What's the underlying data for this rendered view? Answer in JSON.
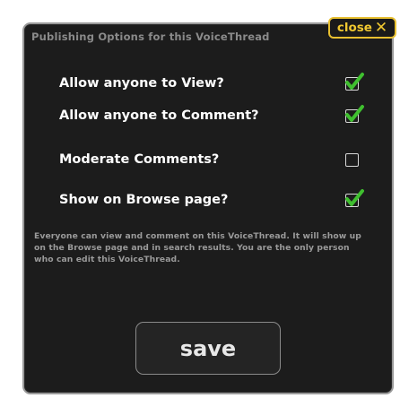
{
  "dialog": {
    "title": "Publishing Options for this VoiceThread",
    "close_label": "close",
    "close_glyph": "✕",
    "options": [
      {
        "label": "Allow anyone to View?",
        "checked": true
      },
      {
        "label": "Allow anyone to Comment?",
        "checked": true
      },
      {
        "label": "Moderate Comments?",
        "checked": false
      },
      {
        "label": "Show on Browse page?",
        "checked": true
      }
    ],
    "info": "Everyone can view and comment on this VoiceThread. It will show up on the Browse page and in search results. You are the only person who can edit this VoiceThread.",
    "save_label": "save"
  },
  "colors": {
    "accent": "#e8c030",
    "check": "#3fbf2f",
    "background": "#1c1c1c"
  },
  "icons": {
    "close": "close-x-icon",
    "check": "green-checkmark-icon"
  }
}
